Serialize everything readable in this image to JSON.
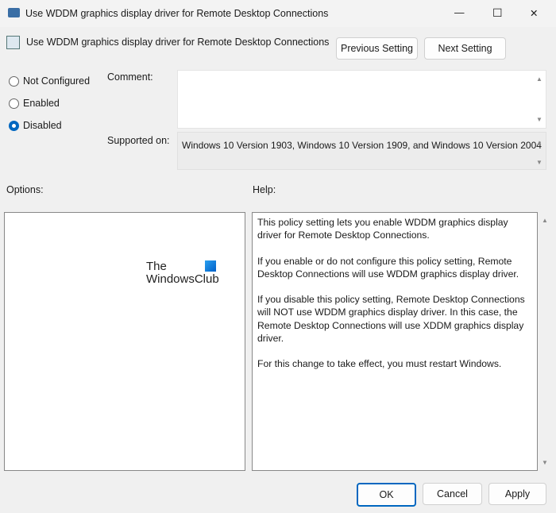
{
  "window": {
    "title": "Use WDDM graphics display driver for Remote Desktop Connections",
    "minimize": "—",
    "maximize": "☐",
    "close": "✕"
  },
  "header": {
    "setting_name": "Use WDDM graphics display driver for Remote Desktop Connections",
    "previous": "Previous Setting",
    "next": "Next Setting"
  },
  "state": {
    "options": [
      {
        "label": "Not Configured",
        "selected": false
      },
      {
        "label": "Enabled",
        "selected": false
      },
      {
        "label": "Disabled",
        "selected": true
      }
    ]
  },
  "comment": {
    "label": "Comment:",
    "value": ""
  },
  "supported": {
    "label": "Supported on:",
    "value": "Windows 10 Version 1903, Windows 10 Version 1909, and Windows 10 Version 2004"
  },
  "options_label": "Options:",
  "help_label": "Help:",
  "watermark": {
    "line1": "The",
    "line2": "WindowsClub"
  },
  "help": [
    "This policy setting lets you enable WDDM graphics display driver for Remote Desktop Connections.",
    "If you enable or do not configure this policy setting, Remote Desktop Connections will use WDDM graphics display driver.",
    "If you disable this policy setting, Remote Desktop Connections will NOT use WDDM graphics display driver. In this case, the Remote Desktop Connections will use XDDM graphics display driver.",
    "For this change to take effect, you must restart Windows."
  ],
  "footer": {
    "ok": "OK",
    "cancel": "Cancel",
    "apply": "Apply"
  },
  "colors": {
    "accent": "#0067c0"
  }
}
